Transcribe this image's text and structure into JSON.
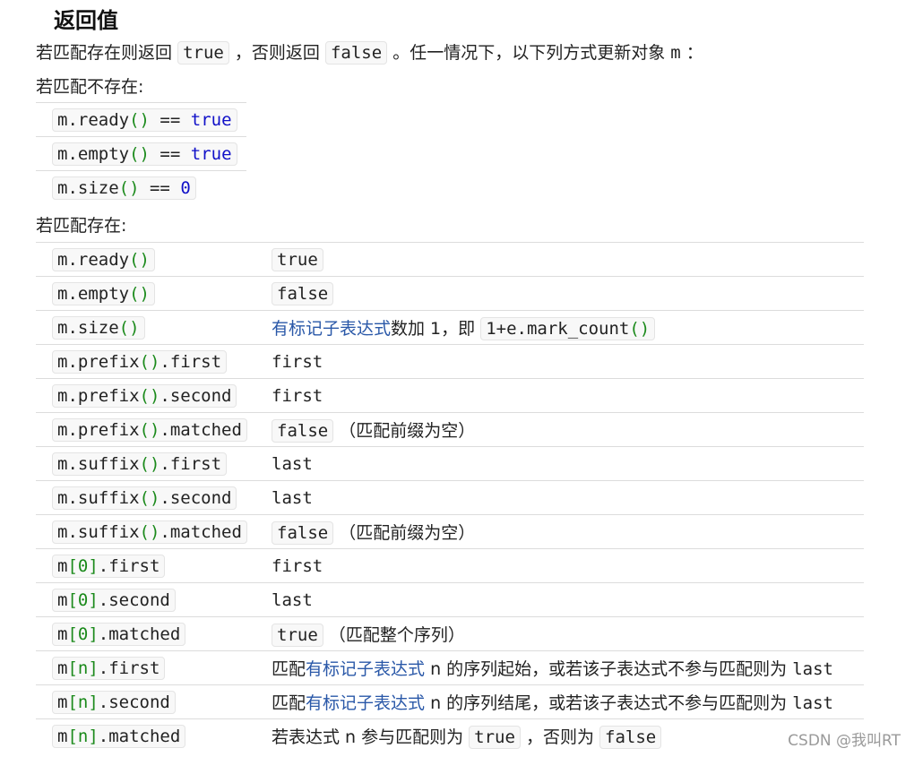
{
  "heading": "返回值",
  "intro": {
    "t1": "若匹配存在则返回",
    "true": "true",
    "t2": "，否则返回",
    "false": "false",
    "t3": "。任一情况下，以下列方式更新对象",
    "m": "m",
    "t4": "："
  },
  "nomatch_label": "若匹配不存在:",
  "nomatch_rows": [
    {
      "obj": "m",
      "method": ".ready",
      "paren": "()",
      "op": " == ",
      "val": "true"
    },
    {
      "obj": "m",
      "method": ".empty",
      "paren": "()",
      "op": " == ",
      "val": "true"
    },
    {
      "obj": "m",
      "method": ".size",
      "paren": "()",
      "op": " == ",
      "val": "0"
    }
  ],
  "match_label": "若匹配存在:",
  "rows": [
    {
      "k1": "m.ready",
      "kp": "()",
      "k2": "",
      "v": "true"
    },
    {
      "k1": "m.empty",
      "kp": "()",
      "k2": "",
      "v": "false"
    },
    {
      "k1": "m.size",
      "kp": "()",
      "k2": "",
      "link": "有标记子表达式",
      "t": "数加 1，即",
      "code_a": "1+e.mark_count",
      "code_p": "()"
    },
    {
      "k1": "m.prefix",
      "kp": "()",
      "k2": ".first",
      "v": "first"
    },
    {
      "k1": "m.prefix",
      "kp": "()",
      "k2": ".second",
      "v": "first"
    },
    {
      "k1": "m.prefix",
      "kp": "()",
      "k2": ".matched",
      "v": "false",
      "note": "（匹配前缀为空）"
    },
    {
      "k1": "m.suffix",
      "kp": "()",
      "k2": ".first",
      "v": "last"
    },
    {
      "k1": "m.suffix",
      "kp": "()",
      "k2": ".second",
      "v": "last"
    },
    {
      "k1": "m.suffix",
      "kp": "()",
      "k2": ".matched",
      "v": "false",
      "note": "（匹配前缀为空）"
    },
    {
      "k1": "m",
      "kb": "[0]",
      "k2": ".first",
      "v": "first"
    },
    {
      "k1": "m",
      "kb": "[0]",
      "k2": ".second",
      "v": "last"
    },
    {
      "k1": "m",
      "kb": "[0]",
      "k2": ".matched",
      "v": "true",
      "note": "（匹配整个序列）"
    },
    {
      "k1": "m",
      "kb": "[n]",
      "k2": ".first",
      "pre": "匹配",
      "link": "有标记子表达式",
      "t": " n 的序列起始，或若该子表达式不参与匹配则为 ",
      "tail": "last"
    },
    {
      "k1": "m",
      "kb": "[n]",
      "k2": ".second",
      "pre": "匹配",
      "link": "有标记子表达式",
      "t": " n 的序列结尾，或若该子表达式不参与匹配则为 ",
      "tail": "last"
    },
    {
      "k1": "m",
      "kb": "[n]",
      "k2": ".matched",
      "t": "若表达式 n 参与匹配则为",
      "va": "true",
      "t2": "，否则为",
      "vb": "false"
    }
  ],
  "watermark": "CSDN @我叫RT"
}
